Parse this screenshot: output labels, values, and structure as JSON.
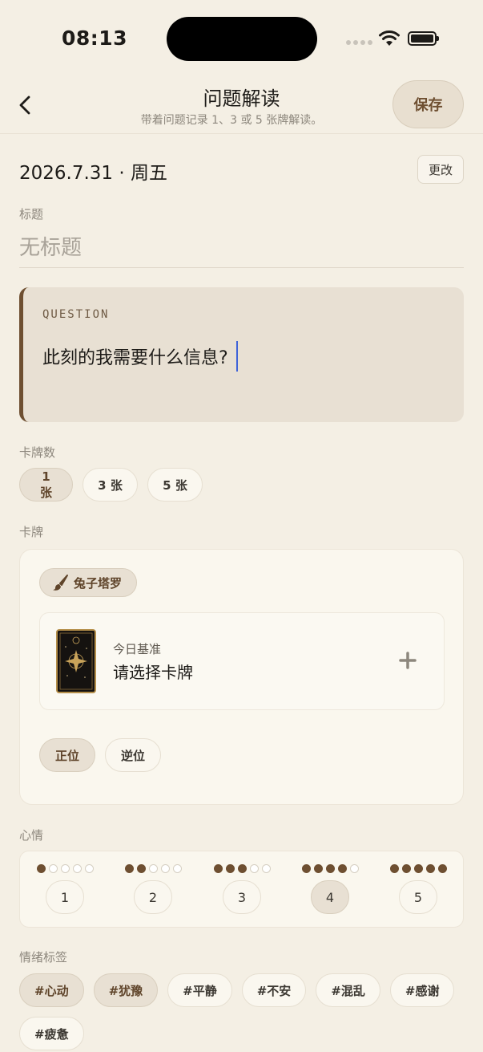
{
  "status_bar": {
    "time": "08:13"
  },
  "header": {
    "title": "问题解读",
    "subtitle": "带着问题记录 1、3 或 5 张牌解读。",
    "save_label": "保存"
  },
  "date": {
    "value": "2026.7.31 · 周五",
    "change_label": "更改"
  },
  "title_field": {
    "label": "标题",
    "placeholder": "无标题",
    "value": ""
  },
  "question": {
    "tag": "QUESTION",
    "text": "此刻的我需要什么信息?"
  },
  "card_count": {
    "label": "卡牌数",
    "options": [
      "1 张",
      "3 张",
      "5 张"
    ],
    "selected": "1 张"
  },
  "cards": {
    "label": "卡牌",
    "deck_name": "兔子塔罗",
    "slot_label": "今日基准",
    "slot_prompt": "请选择卡牌",
    "orientation_options": [
      "正位",
      "逆位"
    ],
    "orientation_selected": "正位"
  },
  "mood": {
    "label": "心情",
    "levels": [
      {
        "value": "1",
        "filled": 1
      },
      {
        "value": "2",
        "filled": 2
      },
      {
        "value": "3",
        "filled": 3
      },
      {
        "value": "4",
        "filled": 4
      },
      {
        "value": "5",
        "filled": 5
      }
    ],
    "selected": "4"
  },
  "emotion_tags": {
    "label": "情绪标签",
    "items": [
      "#心动",
      "#犹豫",
      "#平静",
      "#不安",
      "#混乱",
      "#感谢",
      "#疲惫"
    ],
    "selected": [
      "#心动",
      "#犹豫"
    ]
  },
  "colors": {
    "accent": "#6e4f31",
    "background": "#f4efe4",
    "caret": "#3f63d8"
  }
}
